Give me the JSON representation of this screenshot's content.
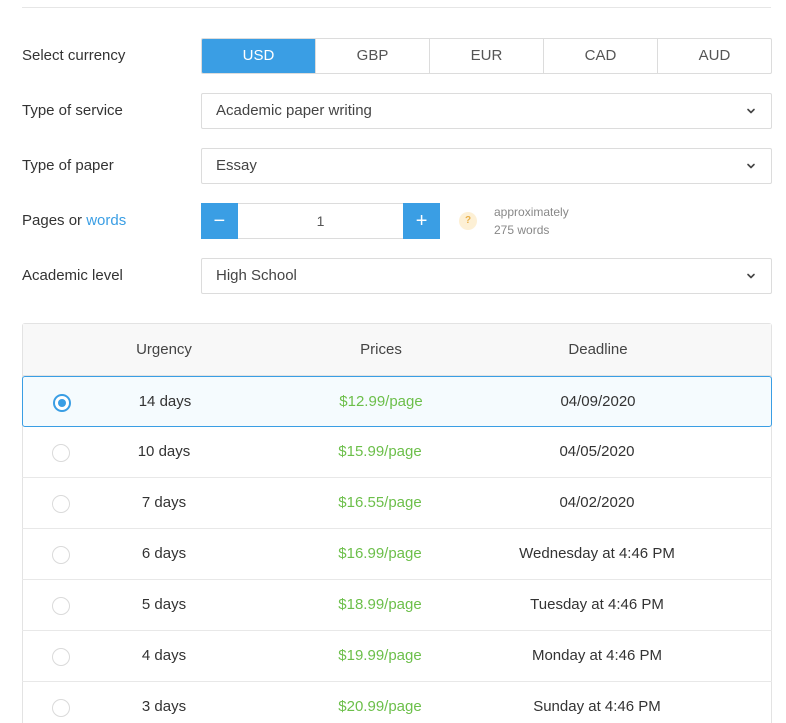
{
  "form": {
    "currency": {
      "label": "Select currency",
      "options": [
        "USD",
        "GBP",
        "EUR",
        "CAD",
        "AUD"
      ],
      "selected": "USD"
    },
    "service": {
      "label": "Type of service",
      "value": "Academic paper writing"
    },
    "paper": {
      "label": "Type of paper",
      "value": "Essay"
    },
    "pages": {
      "label_prefix": "Pages or",
      "label_link": "words",
      "minus": "−",
      "plus": "+",
      "value": "1",
      "help": "?",
      "approx_line1": "approximately",
      "approx_line2": "275 words"
    },
    "level": {
      "label": "Academic level",
      "value": "High School"
    }
  },
  "table": {
    "headers": {
      "urgency": "Urgency",
      "prices": "Prices",
      "deadline": "Deadline"
    },
    "rows": [
      {
        "urgency": "14 days",
        "price": "$12.99/page",
        "deadline": "04/09/2020",
        "selected": true
      },
      {
        "urgency": "10 days",
        "price": "$15.99/page",
        "deadline": "04/05/2020",
        "selected": false
      },
      {
        "urgency": "7 days",
        "price": "$16.55/page",
        "deadline": "04/02/2020",
        "selected": false
      },
      {
        "urgency": "6 days",
        "price": "$16.99/page",
        "deadline": "Wednesday at 4:46 PM",
        "selected": false
      },
      {
        "urgency": "5 days",
        "price": "$18.99/page",
        "deadline": "Tuesday at 4:46 PM",
        "selected": false
      },
      {
        "urgency": "4 days",
        "price": "$19.99/page",
        "deadline": "Monday at 4:46 PM",
        "selected": false
      },
      {
        "urgency": "3 days",
        "price": "$20.99/page",
        "deadline": "Sunday at 4:46 PM",
        "selected": false
      }
    ]
  },
  "colors": {
    "accent": "#3a9ee4",
    "price": "#6cbf4a",
    "help_bg": "#fdf0d5"
  },
  "icons": {
    "select_arrow": "chevron-down-icon",
    "help": "question-icon"
  }
}
